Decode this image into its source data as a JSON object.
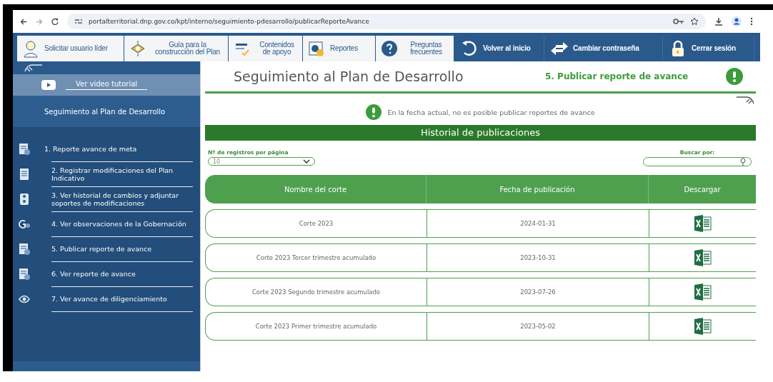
{
  "browser": {
    "url": "portalterritorial.dnp.gov.co/kpt/interno/seguimiento-pdesarrollo/publicarReporteAvance"
  },
  "nav": [
    {
      "label": "Solicitar usuario líder",
      "kind": "light"
    },
    {
      "label": "Guía para la construcción del Plan",
      "kind": "light"
    },
    {
      "label": "Contenidos de apoyo",
      "kind": "light"
    },
    {
      "label": "Reportes",
      "kind": "light"
    },
    {
      "label": "Preguntas frecuentes",
      "kind": "light"
    },
    {
      "label": "Volver al inicio",
      "kind": "dark"
    },
    {
      "label": "Cambiar contraseña",
      "kind": "dark"
    },
    {
      "label": "Cerrar sesión",
      "kind": "dark"
    }
  ],
  "sidebar": {
    "video_link": "Ver video tutorial",
    "title": "Seguimiento al Plan de Desarrollo",
    "items": [
      {
        "label": "1. Reporte avance de meta"
      },
      {
        "label": "2. Registrar modificaciones del Plan Indicativo"
      },
      {
        "label": "3. Ver historial de cambios y adjuntar soportes de modificaciones"
      },
      {
        "label": "4. Ver observaciones de la Gobernación"
      },
      {
        "label": "5. Publicar reporte de avance"
      },
      {
        "label": "6. Ver reporte de avance"
      },
      {
        "label": "7. Ver avance de diligenciamiento"
      }
    ]
  },
  "page": {
    "title": "Seguimiento al Plan de Desarrollo",
    "step": "5. Publicar reporte de avance",
    "notice": "En la fecha actual, no es posible publicar reportes de avance",
    "section": "Historial de publicaciones"
  },
  "controls": {
    "page_size_label": "Nº de registros por página",
    "page_size": "10",
    "search_label": "Buscar por:"
  },
  "table": {
    "columns": [
      "Nombre del corte",
      "Fecha de publicación",
      "Descargar"
    ],
    "rows": [
      {
        "name": "Corte 2023",
        "date": "2024-01-31"
      },
      {
        "name": "Corte 2023 Tercer trimestre acumulado",
        "date": "2023-10-31"
      },
      {
        "name": "Corte 2023 Segundo trimestre acumulado",
        "date": "2023-07-26"
      },
      {
        "name": "Corte 2023 Primer trimestre acumulado",
        "date": "2023-05-02"
      }
    ]
  }
}
